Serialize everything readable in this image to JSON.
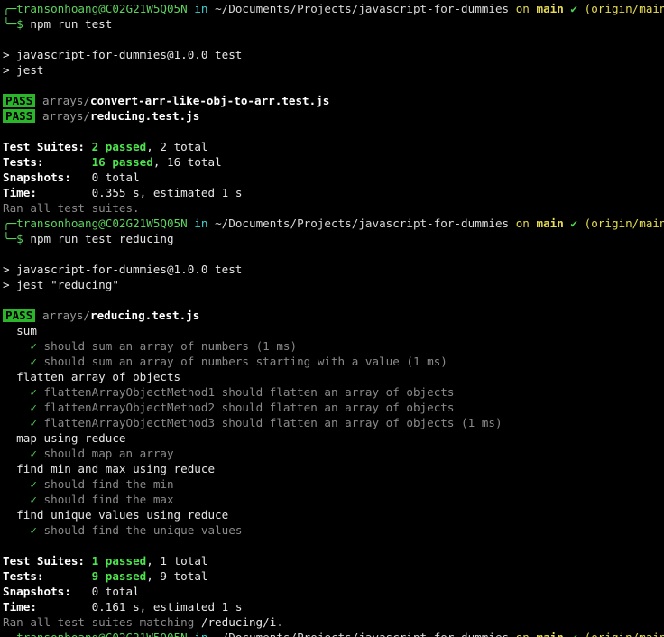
{
  "prompt": {
    "user_host": "transonhoang@C02G21W5Q05N",
    "in": "in",
    "path": "~/Documents/Projects/javascript-for-dummies",
    "on": "on",
    "branch": "main",
    "check": "✔",
    "origin": "(origin/main)",
    "dollar": "$"
  },
  "run1": {
    "command": "npm run test",
    "pkg_line": "> javascript-for-dummies@1.0.0 test",
    "jest_line": "> jest",
    "results": [
      {
        "badge": "PASS",
        "dir": "arrays/",
        "file": "convert-arr-like-obj-to-arr.test.js"
      },
      {
        "badge": "PASS",
        "dir": "arrays/",
        "file": "reducing.test.js"
      }
    ],
    "summary": {
      "suites_label": "Test Suites:",
      "suites_passed": "2 passed",
      "suites_total": ", 2 total",
      "tests_label": "Tests:",
      "tests_passed": "16 passed",
      "tests_total": ", 16 total",
      "snapshots_label": "Snapshots:",
      "snapshots_value": "0 total",
      "time_label": "Time:",
      "time_value": "0.355 s, estimated 1 s",
      "ran": "Ran all test suites."
    }
  },
  "run2": {
    "command": "npm run test reducing",
    "pkg_line": "> javascript-for-dummies@1.0.0 test",
    "jest_line": "> jest \"reducing\"",
    "result": {
      "badge": "PASS",
      "dir": "arrays/",
      "file": "reducing.test.js"
    },
    "groups": [
      {
        "name": "sum",
        "tests": [
          "should sum an array of numbers (1 ms)",
          "should sum an array of numbers starting with a value (1 ms)"
        ]
      },
      {
        "name": "flatten array of objects",
        "tests": [
          "flattenArrayObjectMethod1 should flatten an array of objects",
          "flattenArrayObjectMethod2 should flatten an array of objects",
          "flattenArrayObjectMethod3 should flatten an array of objects (1 ms)"
        ]
      },
      {
        "name": "map using reduce",
        "tests": [
          "should map an array"
        ]
      },
      {
        "name": "find min and max using reduce",
        "tests": [
          "should find the min",
          "should find the max"
        ]
      },
      {
        "name": "find unique values using reduce",
        "tests": [
          "should find the unique values"
        ]
      }
    ],
    "summary": {
      "suites_label": "Test Suites:",
      "suites_passed": "1 passed",
      "suites_total": ", 1 total",
      "tests_label": "Tests:",
      "tests_passed": "9 passed",
      "tests_total": ", 9 total",
      "snapshots_label": "Snapshots:",
      "snapshots_value": "0 total",
      "time_label": "Time:",
      "time_value": "0.161 s, estimated 1 s",
      "ran": "Ran all test suites matching ",
      "ran_pattern": "/reducing/i",
      "ran_end": "."
    }
  },
  "tick": "✓",
  "colors": {
    "background": "#000000",
    "pass_badge": "#2bb52b",
    "green": "#5ed25e",
    "yellow": "#e6db52",
    "cyan": "#3fd1d1"
  }
}
